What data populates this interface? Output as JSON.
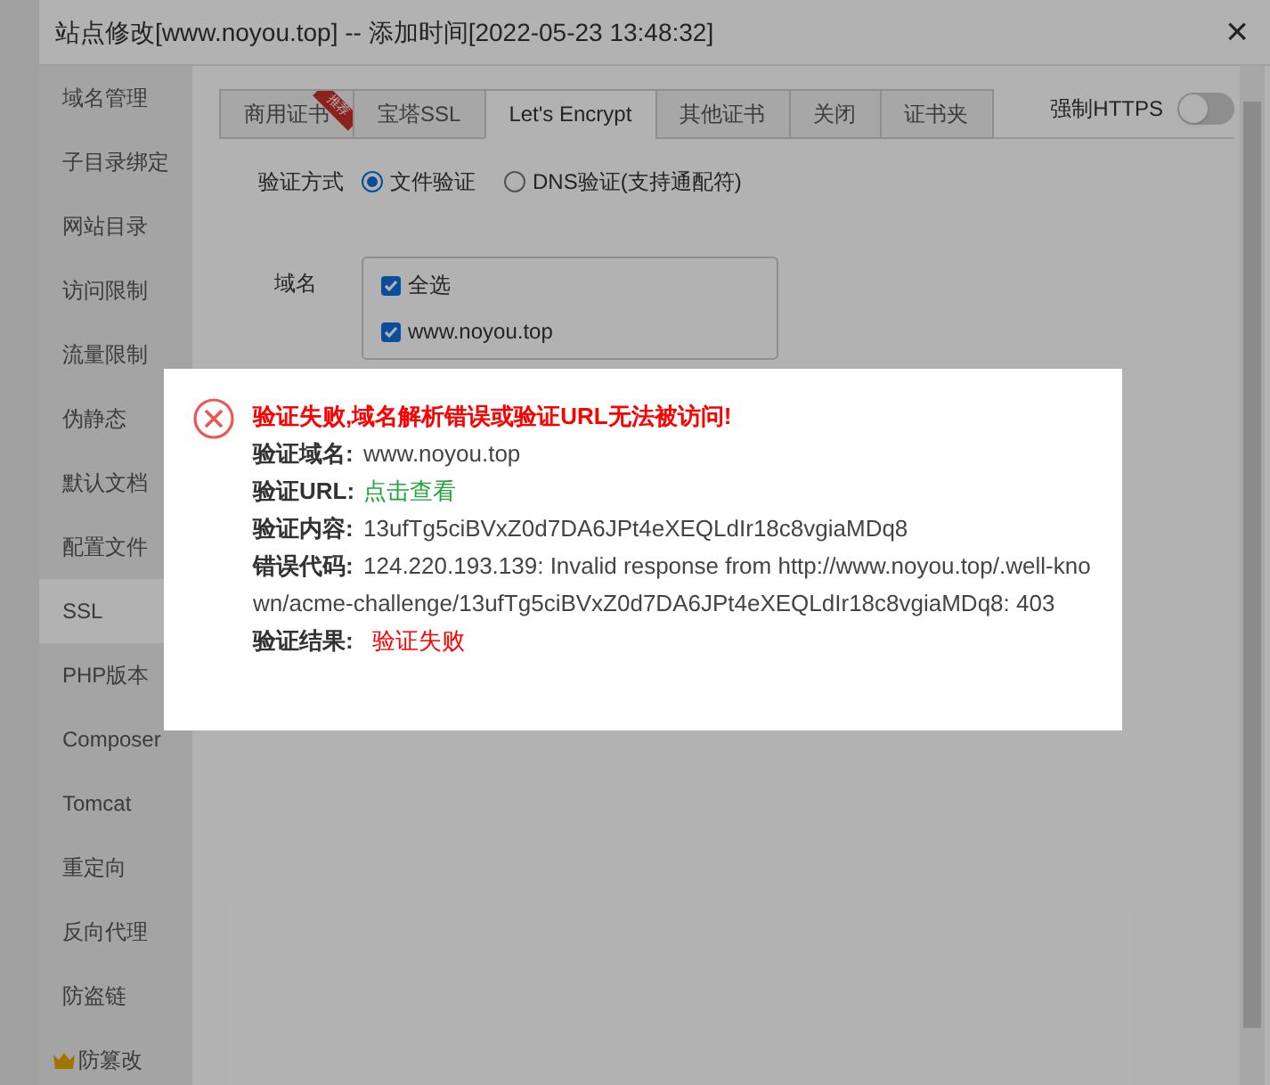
{
  "window": {
    "title": "站点修改[www.noyou.top] -- 添加时间[2022-05-23 13:48:32]",
    "close": "×"
  },
  "sidebar": {
    "items": [
      {
        "label": "域名管理",
        "selected": false,
        "kind": "plain"
      },
      {
        "label": "子目录绑定",
        "selected": false,
        "kind": "plain"
      },
      {
        "label": "网站目录",
        "selected": false,
        "kind": "plain"
      },
      {
        "label": "访问限制",
        "selected": false,
        "kind": "plain"
      },
      {
        "label": "流量限制",
        "selected": false,
        "kind": "plain"
      },
      {
        "label": "伪静态",
        "selected": false,
        "kind": "plain"
      },
      {
        "label": "默认文档",
        "selected": false,
        "kind": "plain"
      },
      {
        "label": "配置文件",
        "selected": false,
        "kind": "plain"
      },
      {
        "label": "SSL",
        "selected": true,
        "kind": "plain"
      },
      {
        "label": "PHP版本",
        "selected": false,
        "kind": "plain"
      },
      {
        "label": "Composer",
        "selected": false,
        "kind": "plain"
      },
      {
        "label": "Tomcat",
        "selected": false,
        "kind": "plain"
      },
      {
        "label": "重定向",
        "selected": false,
        "kind": "plain"
      },
      {
        "label": "反向代理",
        "selected": false,
        "kind": "plain"
      },
      {
        "label": "防盗链",
        "selected": false,
        "kind": "plain"
      },
      {
        "label": "防篡改",
        "selected": false,
        "kind": "crown"
      }
    ]
  },
  "tabs": [
    {
      "label": "商用证书",
      "selected": false,
      "badge": "推荐"
    },
    {
      "label": "宝塔SSL",
      "selected": false
    },
    {
      "label": "Let's Encrypt",
      "selected": true
    },
    {
      "label": "其他证书",
      "selected": false
    },
    {
      "label": "关闭",
      "selected": false
    },
    {
      "label": "证书夹",
      "selected": false
    }
  ],
  "force_https": {
    "label": "强制HTTPS",
    "on": false
  },
  "verify_method": {
    "label": "验证方式",
    "options": [
      {
        "label": "文件验证",
        "selected": true
      },
      {
        "label": "DNS验证(支持通配符)",
        "selected": false
      }
    ]
  },
  "domains": {
    "label": "域名",
    "items": [
      {
        "label": "全选",
        "checked": true
      },
      {
        "label": "www.noyou.top",
        "checked": true
      }
    ]
  },
  "alert": {
    "title": "验证失败,域名解析错误或验证URL无法被访问!",
    "rows": [
      {
        "label": "验证域名:",
        "value": "www.noyou.top",
        "kind": "text"
      },
      {
        "label": "验证URL:",
        "value": "点击查看",
        "kind": "link"
      },
      {
        "label": "验证内容:",
        "value": "13ufTg5ciBVxZ0d7DA6JPt4eXEQLdIr18c8vgiaMDq8",
        "kind": "text"
      },
      {
        "label": "错误代码:",
        "value": "124.220.193.139: Invalid response from http://www.noyou.top/.well-known/acme-challenge/13ufTg5ciBVxZ0d7DA6JPt4eXEQLdIr18c8vgiaMDq8: 403",
        "kind": "text"
      },
      {
        "label": "验证结果:",
        "value": "验证失败",
        "kind": "error"
      }
    ]
  }
}
